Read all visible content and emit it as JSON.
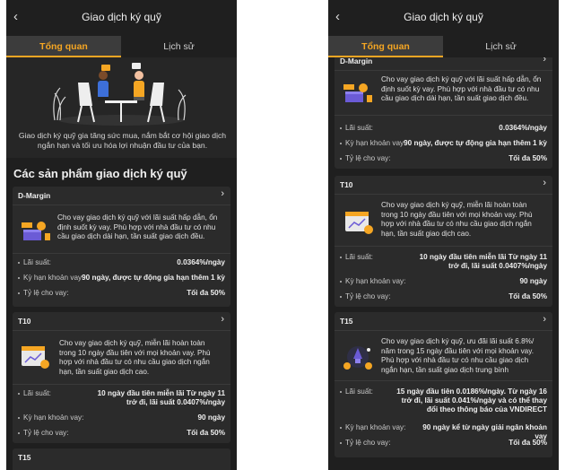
{
  "header": {
    "back_icon": "‹",
    "title": "Giao dịch ký quỹ"
  },
  "tabs": [
    {
      "label": "Tổng quan"
    },
    {
      "label": "Lịch sử"
    }
  ],
  "hero": {
    "description": "Giao dịch ký quỹ gia tăng sức mua, nắm bắt cơ hội giao dịch ngắn hạn và tối ưu hóa lợi nhuận đầu tư của bạn."
  },
  "section_title": "Các sản phẩm giao dịch ký quỹ",
  "products": [
    {
      "name": "D-Margin",
      "description": "Cho vay giao dịch ký quỹ với lãi suất hấp dẫn, ổn định suốt kỳ vay. Phù hợp với nhà đầu tư có nhu cầu giao dịch dài hạn, tần suất giao dịch đều.",
      "rows": [
        {
          "label": "Lãi suất:",
          "value": "0.0364%/ngày"
        },
        {
          "label": "Kỳ hạn khoản vay:",
          "value": "90 ngày, được tự động gia hạn thêm 1 kỳ"
        },
        {
          "label": "Tỷ lệ cho vay:",
          "value": "Tối đa 50%"
        }
      ]
    },
    {
      "name": "T10",
      "description": "Cho vay giao dịch ký quỹ, miễn lãi hoàn toàn trong 10 ngày đầu tiên với mọi khoản vay. Phù hợp với nhà đầu tư có nhu cầu giao dịch ngắn hạn, tần suất giao dịch cao.",
      "rows": [
        {
          "label": "Lãi suất:",
          "value": "10 ngày đầu tiên miễn lãi Từ ngày 11 trở đi, lãi suất 0.0407%/ngày"
        },
        {
          "label": "Kỳ hạn khoản vay:",
          "value": "90 ngày"
        },
        {
          "label": "Tỷ lệ cho vay:",
          "value": "Tối đa 50%"
        }
      ]
    },
    {
      "name": "T15",
      "description": "Cho vay giao dịch ký quỹ, ưu đãi lãi suất 6.8%/ năm trong 15 ngày đầu tiên với mọi khoản vay. Phù hợp với nhà đầu tư có nhu cầu giao dịch ngắn hạn, tần suất giao dịch trung bình",
      "rows": [
        {
          "label": "Lãi suất:",
          "value": "15 ngày đầu tiên 0.0186%/ngày. Từ ngày 16 trở đi, lãi suất 0.041%/ngày và có thể thay đổi theo thông báo của VNDIRECT"
        },
        {
          "label": "Kỳ hạn khoản vay:",
          "value": "90 ngày kể từ ngày giải ngân khoản vay"
        },
        {
          "label": "Tỷ lệ cho vay:",
          "value": "Tối đa 50%"
        }
      ]
    }
  ],
  "colors": {
    "accent": "#f5a623",
    "background": "#1f1f1f",
    "card": "#2b2b2b"
  }
}
